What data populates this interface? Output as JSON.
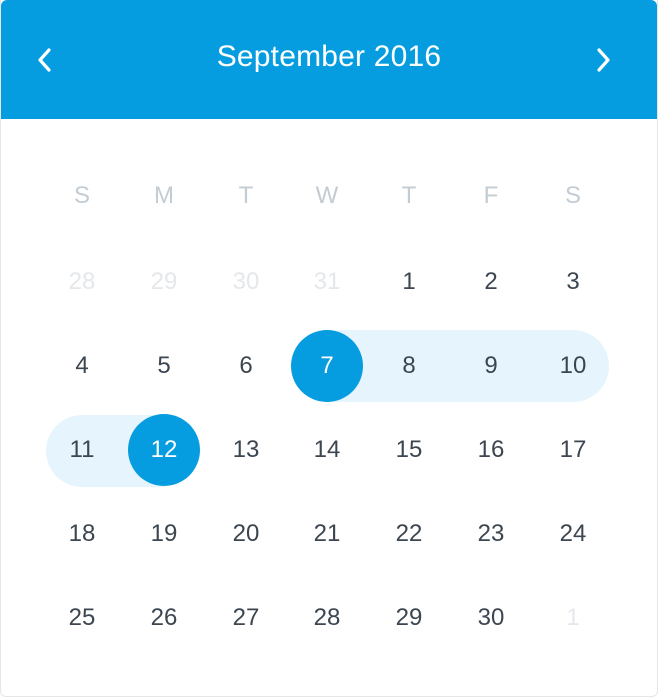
{
  "header": {
    "title": "September 2016",
    "prev_icon": "chevron-left-icon",
    "next_icon": "chevron-right-icon"
  },
  "weekdays": [
    "S",
    "M",
    "T",
    "W",
    "T",
    "F",
    "S"
  ],
  "weeks": [
    [
      "28",
      "29",
      "30",
      "31",
      "1",
      "2",
      "3"
    ],
    [
      "4",
      "5",
      "6",
      "7",
      "8",
      "9",
      "10"
    ],
    [
      "11",
      "12",
      "13",
      "14",
      "15",
      "16",
      "17"
    ],
    [
      "18",
      "19",
      "20",
      "21",
      "22",
      "23",
      "24"
    ],
    [
      "25",
      "26",
      "27",
      "28",
      "29",
      "30",
      "1"
    ]
  ],
  "selection": {
    "start": "7",
    "end": "12"
  },
  "colors": {
    "accent": "#069de0",
    "range": "#e6f5fd",
    "text": "#3c4650",
    "muted": "#e4e8eb",
    "weekday": "#c3ccd3"
  }
}
